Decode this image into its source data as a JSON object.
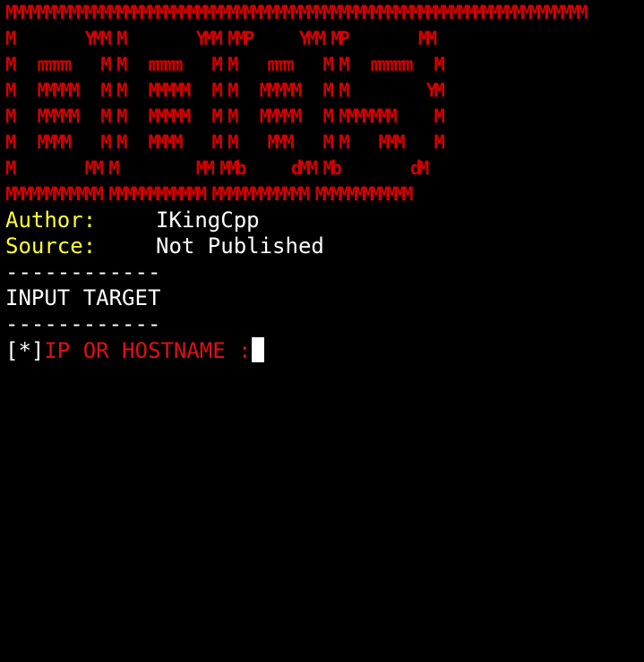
{
  "banner": {
    "lines": [
      "MMMMMMMMMMMMMMMMMMMMMMMMMMMMMMMMMMMMMMMMMMMMMMMMMMMMMMMMMMMMMMMMMMMMMMMMM",
      "M         YMM M         YMM MMP      YMM MP         MM",
      "M   mmmm    M M   mmmm    M M    mmm    M M   mmmmm   M",
      "M   MMMMM   M M   MMMMM   M M   MMMMM   M M          YM",
      "M   MMMMM   M M   MMMMM   M M   MMMMM   M MMMMMMM     M",
      "M   MMMM    M M   MMMM    M M    MMM    M M    MMM    M",
      "M         MM M          MM MMb      dMM Mb         dM",
      "MMMMMMMMMMMM MMMMMMMMMMMM MMMMMMMMMMMM MMMMMMMMMMMM"
    ],
    "color": "#d40000"
  },
  "info": {
    "author_label": "Author:",
    "author_value": "IKingCpp",
    "source_label": "Source:",
    "source_value": "Not Published"
  },
  "section": {
    "separator_top": "------------",
    "title": "INPUT TARGET",
    "separator_bottom": "------------"
  },
  "prompt": {
    "prefix": "[*]",
    "text": "IP OR HOSTNAME :",
    "input_value": ""
  },
  "colors": {
    "background": "#000000",
    "label_yellow": "#ffff33",
    "text_white": "#ffffff",
    "accent_red": "#e01010"
  }
}
